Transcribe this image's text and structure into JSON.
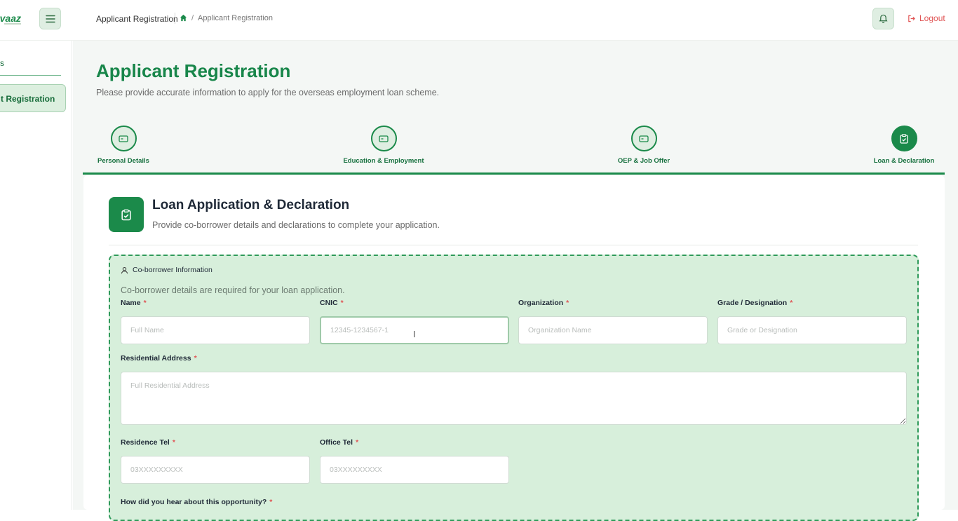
{
  "header": {
    "logo_text": "vaaz",
    "breadcrumb_title": "Applicant Registration",
    "breadcrumb_current": "Applicant Registration",
    "breadcrumb_separator": "/",
    "logout_label": "Logout"
  },
  "sidebar": {
    "section_label": "s",
    "active_item_label": "t Registration"
  },
  "page": {
    "title": "Applicant Registration",
    "subtitle": "Please provide accurate information to apply for the overseas employment loan scheme."
  },
  "steps": [
    {
      "label": "Personal Details",
      "icon": "card-icon",
      "active": false
    },
    {
      "label": "Education & Employment",
      "icon": "card-icon",
      "active": false
    },
    {
      "label": "OEP & Job Offer",
      "icon": "card-icon",
      "active": false
    },
    {
      "label": "Loan & Declaration",
      "icon": "clipboard-check-icon",
      "active": true
    }
  ],
  "section": {
    "title": "Loan Application & Declaration",
    "subtitle": "Provide co-borrower details and declarations to complete your application.",
    "coborrower": {
      "heading": "Co-borrower Information",
      "note": "Co-borrower details are required for your loan application.",
      "required_mark": "*",
      "fields": {
        "name": {
          "label": "Name",
          "placeholder": "Full Name",
          "value": ""
        },
        "cnic": {
          "label": "CNIC",
          "placeholder": "12345-1234567-1",
          "value": ""
        },
        "organization": {
          "label": "Organization",
          "placeholder": "Organization Name",
          "value": ""
        },
        "grade": {
          "label": "Grade / Designation",
          "placeholder": "Grade or Designation",
          "value": ""
        },
        "address": {
          "label": "Residential Address",
          "placeholder": "Full Residential Address",
          "value": ""
        },
        "residence_tel": {
          "label": "Residence Tel",
          "placeholder": "03XXXXXXXXX",
          "value": ""
        },
        "office_tel": {
          "label": "Office Tel",
          "placeholder": "03XXXXXXXXX",
          "value": ""
        },
        "hear_about": {
          "label": "How did you hear about this opportunity?"
        }
      }
    }
  },
  "colors": {
    "accent": "#1b8a4a",
    "accent_light": "#d7efdb",
    "danger": "#e05555"
  }
}
